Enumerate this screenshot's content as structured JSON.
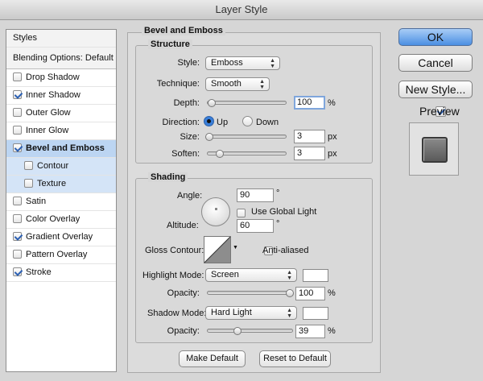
{
  "window": {
    "title": "Layer Style"
  },
  "sidebar": {
    "header": "Styles",
    "blending": "Blending Options: Default",
    "items": [
      {
        "label": "Drop Shadow",
        "checked": false
      },
      {
        "label": "Inner Shadow",
        "checked": true
      },
      {
        "label": "Outer Glow",
        "checked": false
      },
      {
        "label": "Inner Glow",
        "checked": false
      },
      {
        "label": "Bevel and Emboss",
        "checked": true
      },
      {
        "label": "Contour",
        "checked": false
      },
      {
        "label": "Texture",
        "checked": false
      },
      {
        "label": "Satin",
        "checked": false
      },
      {
        "label": "Color Overlay",
        "checked": false
      },
      {
        "label": "Gradient Overlay",
        "checked": true
      },
      {
        "label": "Pattern Overlay",
        "checked": false
      },
      {
        "label": "Stroke",
        "checked": true
      }
    ]
  },
  "panel": {
    "title": "Bevel and Emboss",
    "structure": {
      "legend": "Structure",
      "style_label": "Style:",
      "style_value": "Emboss",
      "technique_label": "Technique:",
      "technique_value": "Smooth",
      "depth_label": "Depth:",
      "depth_value": "100",
      "depth_unit": "%",
      "direction_label": "Direction:",
      "direction_up": "Up",
      "direction_down": "Down",
      "size_label": "Size:",
      "size_value": "3",
      "size_unit": "px",
      "soften_label": "Soften:",
      "soften_value": "3",
      "soften_unit": "px"
    },
    "shading": {
      "legend": "Shading",
      "angle_label": "Angle:",
      "angle_value": "90",
      "angle_unit": "°",
      "global_light_label": "Use Global Light",
      "altitude_label": "Altitude:",
      "altitude_value": "60",
      "altitude_unit": "°",
      "gloss_label": "Gloss Contour:",
      "antialiased_label": "Anti-aliased",
      "highlight_label": "Highlight Mode:",
      "highlight_value": "Screen",
      "opacity_label": "Opacity:",
      "highlight_opacity": "100",
      "opacity_unit": "%",
      "shadow_label": "Shadow Mode:",
      "shadow_value": "Hard Light",
      "shadow_opacity": "39"
    },
    "make_default": "Make Default",
    "reset_default": "Reset to Default"
  },
  "buttons": {
    "ok": "OK",
    "cancel": "Cancel",
    "new_style": "New Style...",
    "preview": "Preview"
  }
}
